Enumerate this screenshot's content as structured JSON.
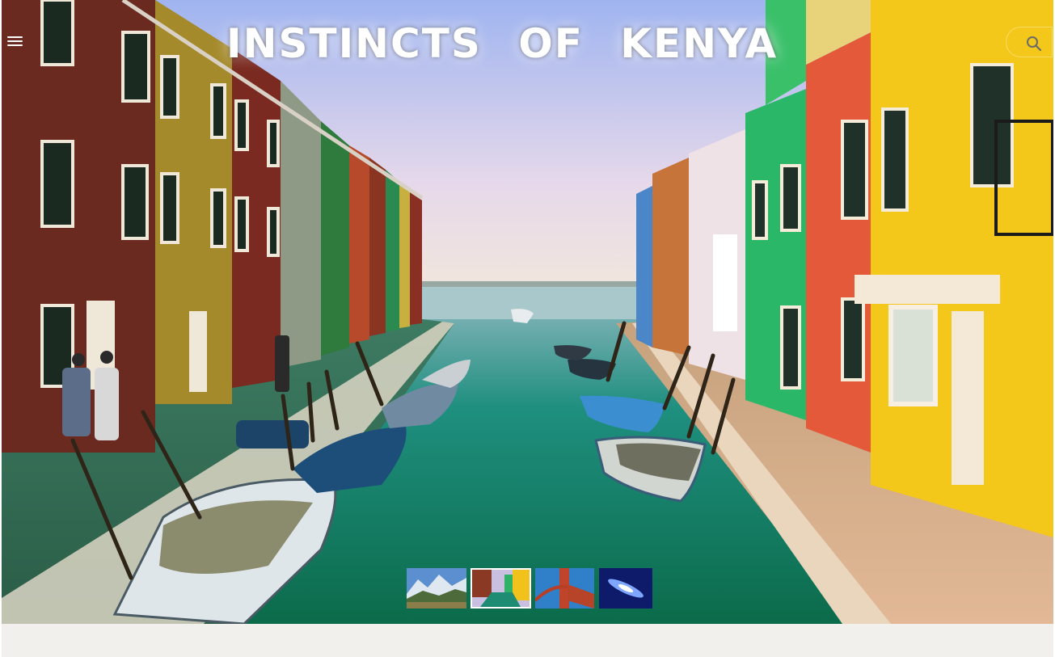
{
  "header": {
    "title": "INSTINCTS OF KENYA",
    "menu_icon": "hamburger-menu-icon",
    "search_icon": "search-icon"
  },
  "hero": {
    "image": "colorful canal street with houses and boats"
  },
  "slider": {
    "active_index": 1,
    "thumbnails": [
      {
        "name": "mountain-lake-thumbnail"
      },
      {
        "name": "canal-houses-thumbnail"
      },
      {
        "name": "red-bridge-thumbnail"
      },
      {
        "name": "blue-light-thumbnail"
      }
    ]
  },
  "colors": {
    "title_text": "#ffffff",
    "footer_band": "#f1f0ec"
  }
}
